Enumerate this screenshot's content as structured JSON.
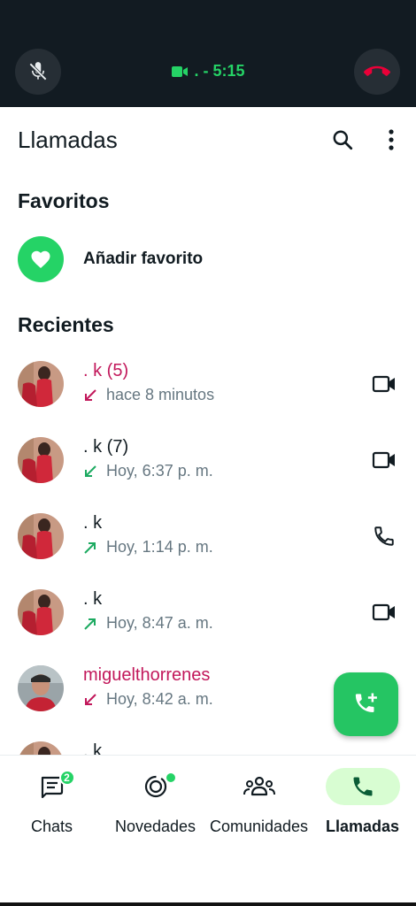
{
  "call_banner": {
    "status_text": ". - 5:15",
    "mute_icon": "mic-off-icon",
    "hangup_icon": "call-end-icon",
    "colors": {
      "background": "#121b22",
      "accent": "#25d366",
      "hangup": "#ea0038"
    }
  },
  "header": {
    "title": "Llamadas",
    "search_icon": "search-icon",
    "more_icon": "more-vertical-icon"
  },
  "favorites": {
    "title": "Favoritos",
    "add_label": "Añadir favorito"
  },
  "recents": {
    "title": "Recientes",
    "items": [
      {
        "name": ". k (5)",
        "missed": true,
        "direction": "incoming",
        "time": "hace 8 minutos",
        "call_type": "video"
      },
      {
        "name": ". k (7)",
        "missed": false,
        "direction": "incoming",
        "time": "Hoy, 6:37 p. m.",
        "call_type": "video"
      },
      {
        "name": ". k",
        "missed": false,
        "direction": "outgoing",
        "time": "Hoy, 1:14 p. m.",
        "call_type": "voice"
      },
      {
        "name": ". k",
        "missed": false,
        "direction": "outgoing",
        "time": "Hoy, 8:47 a. m.",
        "call_type": "video"
      },
      {
        "name": "miguelthorrenes",
        "missed": true,
        "direction": "incoming",
        "time": "Hoy, 8:42 a. m.",
        "call_type": "none"
      },
      {
        "name": ". k",
        "missed": false,
        "direction": "incoming",
        "time": "",
        "call_type": "none"
      }
    ]
  },
  "fab_icon": "add-call-icon",
  "bottom_nav": {
    "items": [
      {
        "label": "Chats",
        "icon": "chats-icon",
        "badge": "2",
        "active": false
      },
      {
        "label": "Novedades",
        "icon": "updates-icon",
        "dot": true,
        "active": false
      },
      {
        "label": "Comunidades",
        "icon": "communities-icon",
        "active": false
      },
      {
        "label": "Llamadas",
        "icon": "calls-icon",
        "active": true
      }
    ]
  },
  "colors": {
    "brand_green": "#25d366",
    "missed_red": "#c2185b",
    "active_pill": "#d8fdd2"
  }
}
